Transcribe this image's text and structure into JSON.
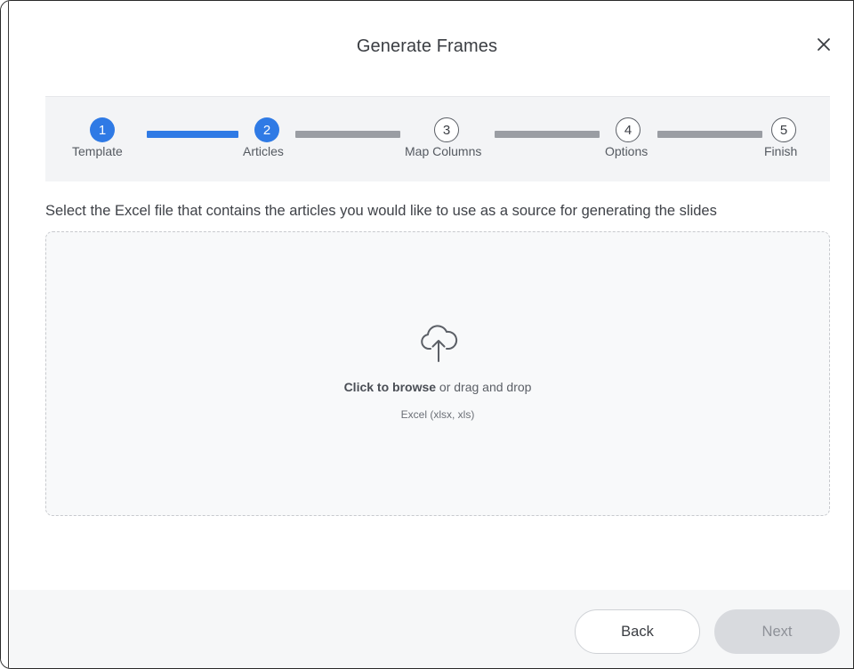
{
  "dialog": {
    "title": "Generate Frames",
    "close_label": "close"
  },
  "stepper": {
    "steps": [
      {
        "number": "1",
        "label": "Template",
        "state": "completed"
      },
      {
        "number": "2",
        "label": "Articles",
        "state": "current"
      },
      {
        "number": "3",
        "label": "Map Columns",
        "state": "upcoming"
      },
      {
        "number": "4",
        "label": "Options",
        "state": "upcoming"
      },
      {
        "number": "5",
        "label": "Finish",
        "state": "upcoming"
      }
    ],
    "colors": {
      "active": "#2f7ae5",
      "inactive": "#9a9da3"
    }
  },
  "instruction": "Select the Excel file that contains the articles you would like to use as a source for generating the slides",
  "dropzone": {
    "icon": "cloud-upload-icon",
    "browse_link": "Click to browse",
    "browse_rest": " or drag and drop",
    "accepted_formats": "Excel (xlsx, xls)"
  },
  "footer": {
    "back_label": "Back",
    "next_label": "Next",
    "next_disabled": true
  }
}
